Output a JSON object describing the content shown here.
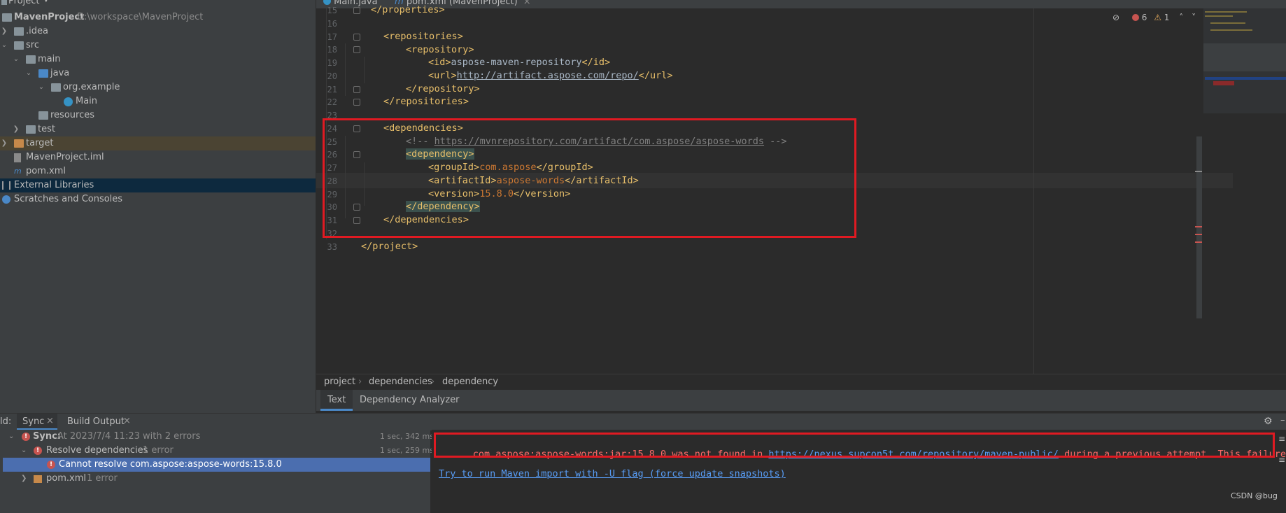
{
  "project": {
    "header": "Project",
    "tree": [
      {
        "label": "MavenProject",
        "path": "D:\\workspace\\MavenProject"
      },
      {
        "label": ".idea"
      },
      {
        "label": "src"
      },
      {
        "label": "main"
      },
      {
        "label": "java"
      },
      {
        "label": "org.example"
      },
      {
        "label": "Main"
      },
      {
        "label": "resources"
      },
      {
        "label": "test"
      },
      {
        "label": "target"
      },
      {
        "label": "MavenProject.iml"
      },
      {
        "label": "pom.xml"
      },
      {
        "label": "External Libraries"
      },
      {
        "label": "Scratches and Consoles"
      }
    ]
  },
  "editor": {
    "tabs": [
      "Main.java",
      "pom.xml (MavenProject)"
    ],
    "inspections": {
      "errors": "6",
      "warnings": "1"
    },
    "breadcrumb": [
      "project",
      "dependencies",
      "dependency"
    ],
    "bottom_tabs": [
      "Text",
      "Dependency Analyzer"
    ],
    "line_numbers": [
      "15",
      "16",
      "17",
      "18",
      "19",
      "20",
      "21",
      "22",
      "23",
      "24",
      "25",
      "26",
      "27",
      "28",
      "29",
      "30",
      "31",
      "32",
      "33"
    ],
    "code": {
      "l15": "</properties>",
      "repositories_open": "repositories",
      "repository_open": "repository",
      "id_tag": "id",
      "id_value": "aspose-maven-repository",
      "url_tag": "url",
      "url_value": "http://artifact.aspose.com/repo/",
      "repository_close": "repository",
      "repositories_close": "repositories",
      "dependencies_open": "dependencies",
      "comment_start": "<!-- ",
      "comment_link": "https://mvnrepository.com/artifact/com.aspose/aspose-words",
      "comment_end": " -->",
      "dependency_open": "dependency",
      "groupId_tag": "groupId",
      "groupId_value": "com.aspose",
      "artifactId_tag": "artifactId",
      "artifactId_value": "aspose-words",
      "version_tag": "version",
      "version_value": "15.8.0",
      "dependency_close": "dependency",
      "dependencies_close": "dependencies",
      "project_close": "</project>"
    }
  },
  "build": {
    "label": "ld:",
    "tabs": [
      "Sync",
      "Build Output"
    ],
    "rows": [
      {
        "title": "Sync:",
        "detail": "At 2023/7/4 11:23 with 2 errors",
        "time": "1 sec, 342 ms"
      },
      {
        "title": "Resolve dependencies",
        "detail": "1 error",
        "time": "1 sec, 259 ms"
      },
      {
        "title": "Cannot resolve com.aspose:aspose-words:15.8.0"
      },
      {
        "title": "pom.xml",
        "detail": "1 error"
      }
    ],
    "error_prefix": "com.aspose:aspose-words:jar:15.8.0 was not found in ",
    "error_link": "https://nexus.supcon5t.com/repository/maven-public/",
    "error_suffix": " during a previous attempt. This failure was ca",
    "suggestion_link": "Try to run Maven import with -U flag (force update snapshots)"
  },
  "watermark": "CSDN @bug",
  "colors": {
    "highlight_box": "#e01a22",
    "selection": "#4b6eaf"
  }
}
